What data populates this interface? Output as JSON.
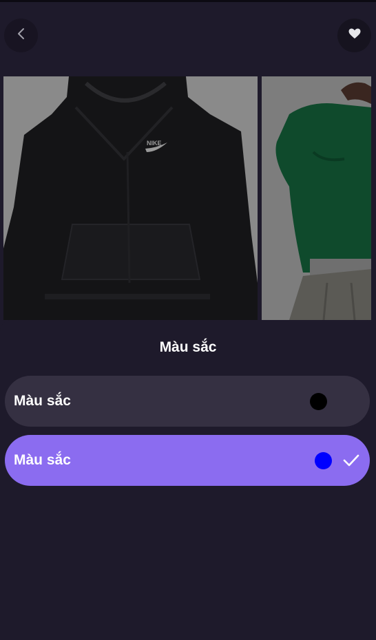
{
  "header": {
    "back_icon": "chevron-left-icon",
    "favorite_icon": "heart-icon"
  },
  "gallery": {
    "images": [
      {
        "description_icon": "black-hoodie-image"
      },
      {
        "description_icon": "green-hoodie-image"
      }
    ],
    "brand_mark": "NIKE"
  },
  "color_sheet": {
    "title": "Màu sắc",
    "options": [
      {
        "label": "Màu sắc",
        "swatch_color": "#000000",
        "selected": false
      },
      {
        "label": "Màu sắc",
        "swatch_color": "#0000ff",
        "selected": true
      }
    ],
    "selected_icon": "checkmark-icon"
  },
  "colors": {
    "background": "#1e1a2b",
    "option_bg": "#353042",
    "option_selected_bg": "#8b6cf0"
  }
}
